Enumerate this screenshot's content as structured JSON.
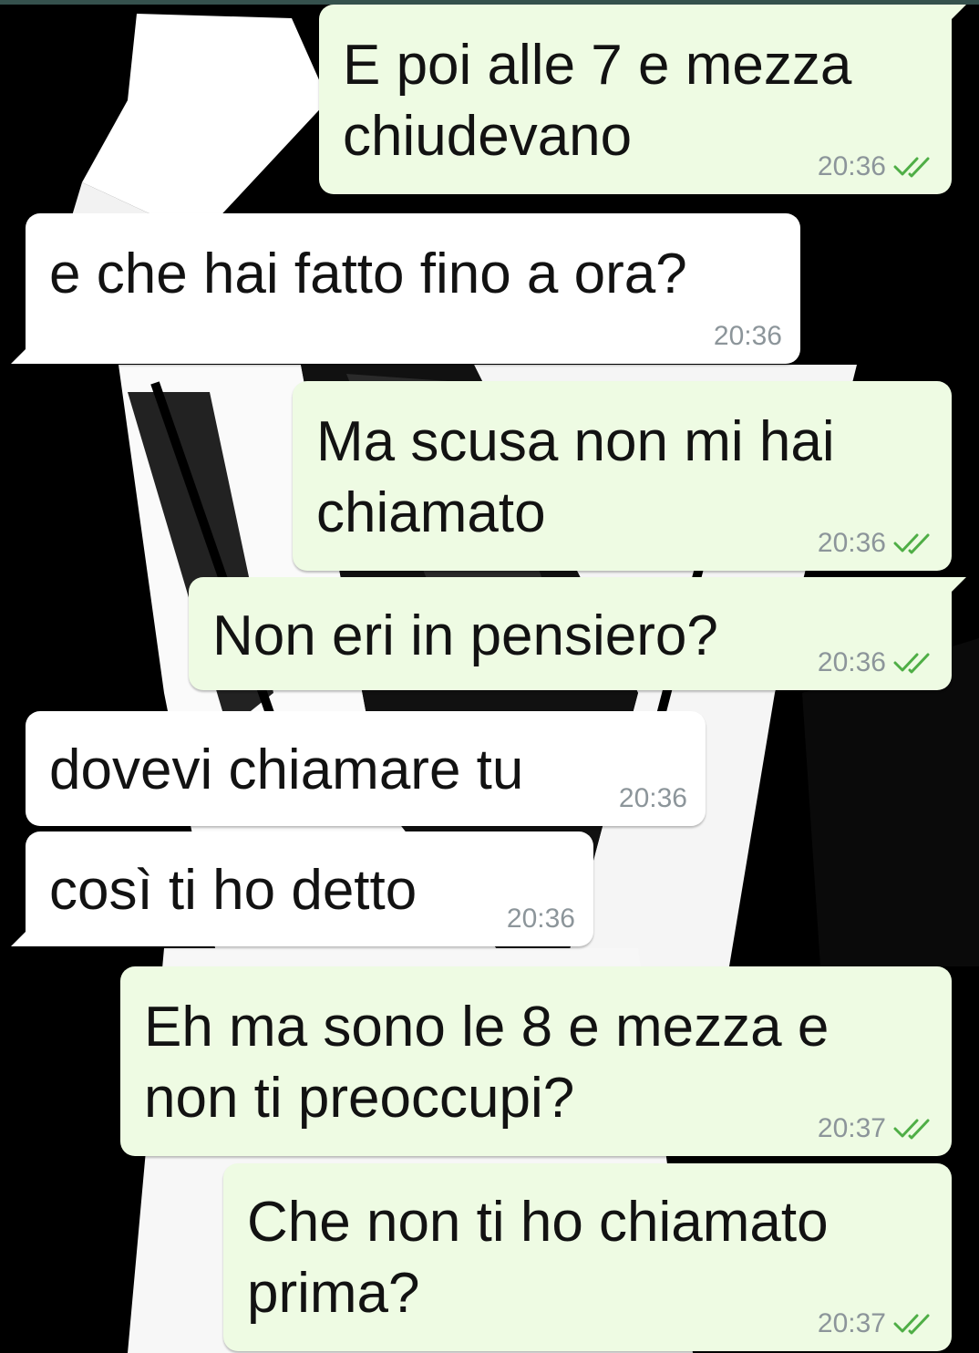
{
  "chat": {
    "tick_color": "#4fae46",
    "messages": [
      {
        "direction": "out",
        "text": "E poi alle 7 e mezza\nchiudevano",
        "time": "20:36",
        "status": "double-check-icon"
      },
      {
        "direction": "in",
        "text": "e che hai fatto fino a ora?",
        "time": "20:36"
      },
      {
        "direction": "out",
        "text": "Ma scusa non mi hai\nchiamato",
        "time": "20:36",
        "status": "double-check-icon"
      },
      {
        "direction": "out",
        "text": "Non eri in pensiero?",
        "time": "20:36",
        "status": "double-check-icon"
      },
      {
        "direction": "in",
        "text": "dovevi chiamare tu",
        "time": "20:36"
      },
      {
        "direction": "in",
        "text": "così ti ho detto",
        "time": "20:36"
      },
      {
        "direction": "out",
        "text": "Eh ma sono le 8 e mezza e\nnon ti preoccupi?",
        "time": "20:37",
        "status": "double-check-icon"
      },
      {
        "direction": "out",
        "text": "Che non ti ho chiamato\nprima?",
        "time": "20:37",
        "status": "double-check-icon"
      }
    ]
  }
}
